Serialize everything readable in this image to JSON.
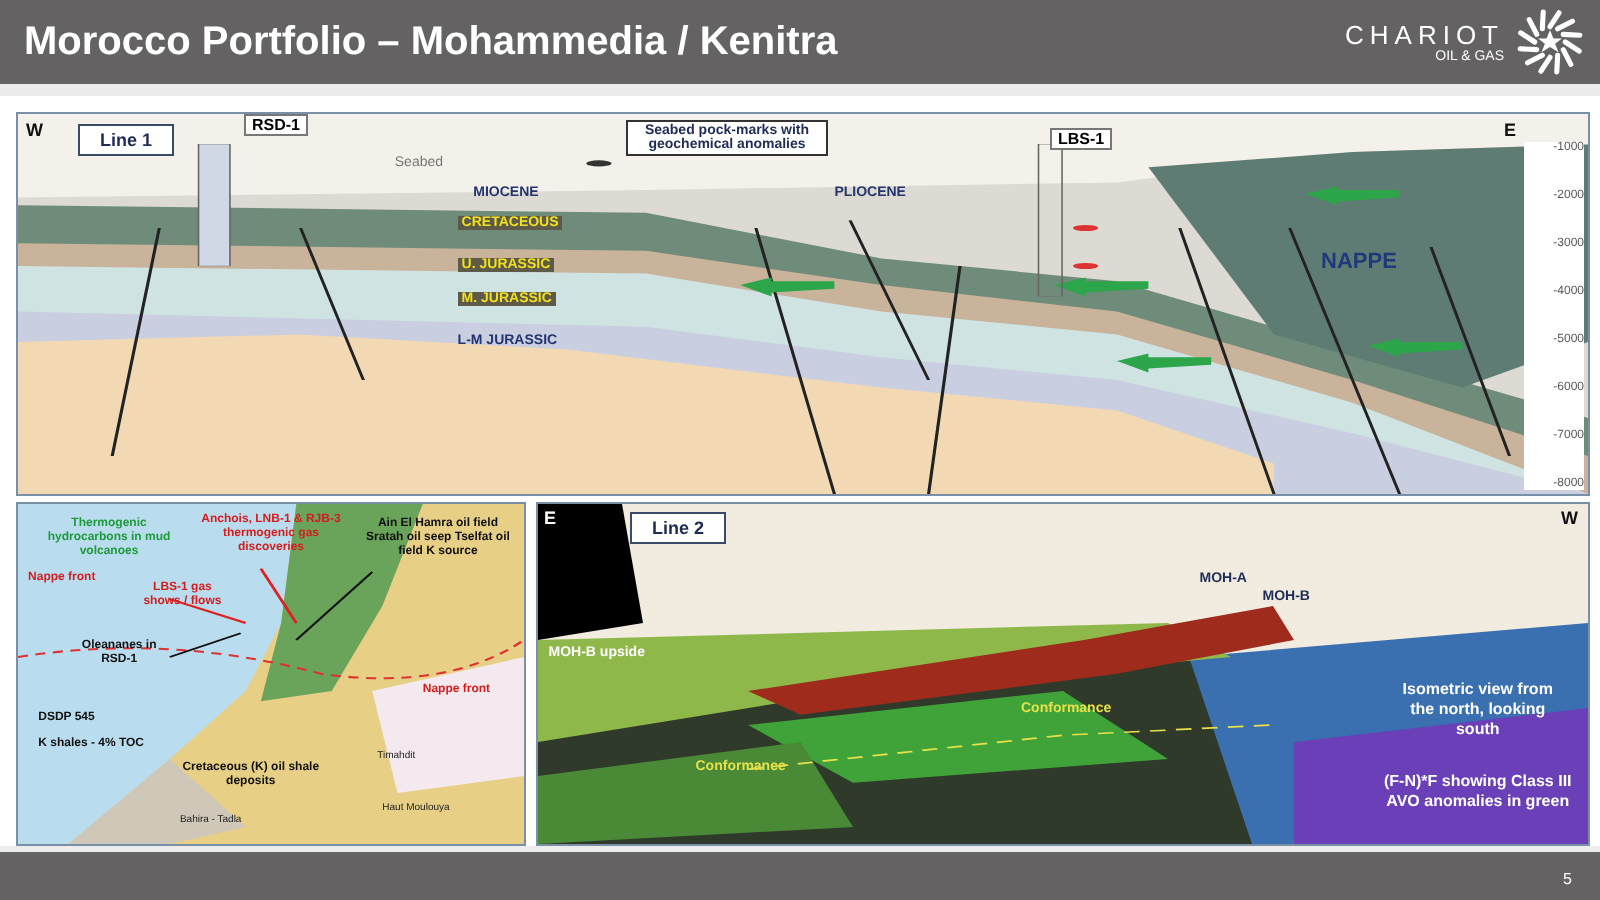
{
  "header": {
    "title": "Morocco Portfolio – Mohammedia / Kenitra",
    "logo_name": "CHARIOT",
    "logo_sub": "OIL & GAS"
  },
  "line1": {
    "line_label": "Line 1",
    "west": "W",
    "east": "E",
    "wells": [
      "RSD-1",
      "LBS-1"
    ],
    "callout": "Seabed pock-marks with geochemical anomalies",
    "labels": [
      {
        "text": "Seabed",
        "kind": "plain"
      },
      {
        "text": "MIOCENE",
        "kind": "unit"
      },
      {
        "text": "CRETACEOUS",
        "kind": "formation"
      },
      {
        "text": "U. JURASSIC",
        "kind": "formation"
      },
      {
        "text": "M. JURASSIC",
        "kind": "formation"
      },
      {
        "text": "L-M JURASSIC",
        "kind": "unit"
      },
      {
        "text": "PLIOCENE",
        "kind": "unit"
      },
      {
        "text": "NAPPE",
        "kind": "big"
      }
    ],
    "depth_ticks": [
      "-1000",
      "-2000",
      "-3000",
      "-4000",
      "-5000",
      "-6000",
      "-7000",
      "-8000"
    ]
  },
  "map": {
    "labels": [
      {
        "text": "Thermogenic hydrocarbons in mud volcanoes",
        "kind": "green"
      },
      {
        "text": "Anchois, LNB-1 & RJB-3 thermogenic gas discoveries",
        "kind": "red"
      },
      {
        "text": "Ain El Hamra oil field Sratah oil seep Tselfat oil field K source",
        "kind": "dark"
      },
      {
        "text": "LBS-1 gas shows / flows",
        "kind": "red"
      },
      {
        "text": "Oleananes in RSD-1",
        "kind": "dark"
      },
      {
        "text": "DSDP 545",
        "kind": "dark"
      },
      {
        "text": "K shales - 4% TOC",
        "kind": "dark"
      },
      {
        "text": "Cretaceous (K) oil shale deposits",
        "kind": "dark"
      },
      {
        "text": "Timahdit",
        "kind": "small"
      },
      {
        "text": "Haut Moulouya",
        "kind": "small"
      },
      {
        "text": "Bahira - Tadla",
        "kind": "small"
      },
      {
        "text": "Nappe front",
        "kind": "front"
      },
      {
        "text": "Nappe front",
        "kind": "front"
      }
    ]
  },
  "line2": {
    "line_label": "Line 2",
    "east": "E",
    "west": "W",
    "labels": [
      {
        "text": "MOH-A",
        "kind": "well"
      },
      {
        "text": "MOH-B",
        "kind": "well"
      },
      {
        "text": "MOH-B upside",
        "kind": "upside"
      },
      {
        "text": "Conformance",
        "kind": "conf"
      },
      {
        "text": "Conformance",
        "kind": "conf"
      },
      {
        "text": "Isometric view from the north, looking south",
        "kind": "note"
      },
      {
        "text": "(F-N)*F showing Class III AVO anomalies in green",
        "kind": "note"
      }
    ]
  },
  "footer": {
    "page": "5"
  }
}
